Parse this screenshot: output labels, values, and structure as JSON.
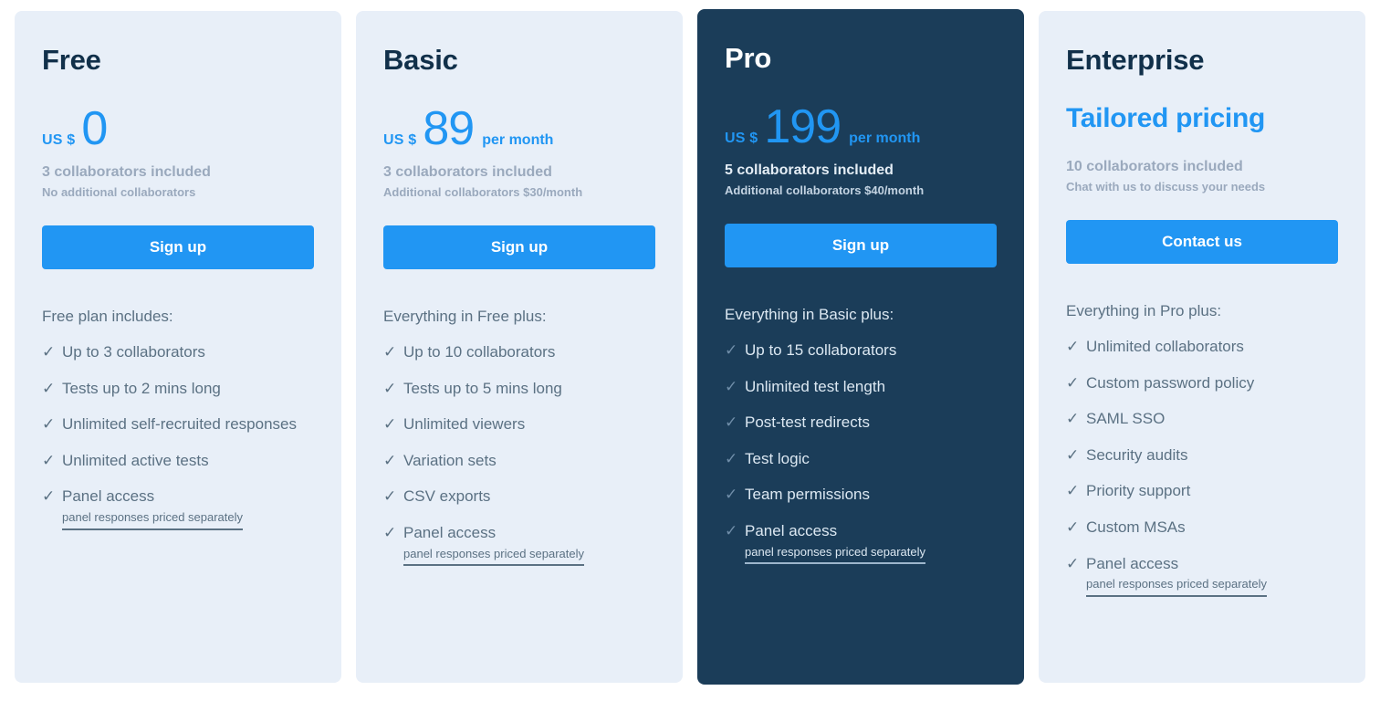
{
  "plans": [
    {
      "name": "Free",
      "featured": false,
      "price": {
        "currency": "US $",
        "amount": "0",
        "period": "",
        "custom": ""
      },
      "collaborators_included": "3 collaborators included",
      "collaborators_additional": "No additional collaborators",
      "cta_label": "Sign up",
      "features_heading": "Free plan includes:",
      "features": [
        {
          "label": "Up to 3 collaborators",
          "note": ""
        },
        {
          "label": "Tests up to 2 mins long",
          "note": ""
        },
        {
          "label": "Unlimited self-recruited responses",
          "note": ""
        },
        {
          "label": "Unlimited active tests",
          "note": ""
        },
        {
          "label": "Panel access",
          "note": "panel responses priced separately"
        }
      ]
    },
    {
      "name": "Basic",
      "featured": false,
      "price": {
        "currency": "US $",
        "amount": "89",
        "period": "per month",
        "custom": ""
      },
      "collaborators_included": "3 collaborators included",
      "collaborators_additional": "Additional collaborators $30/month",
      "cta_label": "Sign up",
      "features_heading": "Everything in Free plus:",
      "features": [
        {
          "label": "Up to 10 collaborators",
          "note": ""
        },
        {
          "label": "Tests up to 5 mins long",
          "note": ""
        },
        {
          "label": "Unlimited viewers",
          "note": ""
        },
        {
          "label": "Variation sets",
          "note": ""
        },
        {
          "label": "CSV exports",
          "note": ""
        },
        {
          "label": "Panel access",
          "note": "panel responses priced separately"
        }
      ]
    },
    {
      "name": "Pro",
      "featured": true,
      "price": {
        "currency": "US $",
        "amount": "199",
        "period": "per month",
        "custom": ""
      },
      "collaborators_included": "5 collaborators included",
      "collaborators_additional": "Additional collaborators $40/month",
      "cta_label": "Sign up",
      "features_heading": "Everything in Basic plus:",
      "features": [
        {
          "label": "Up to 15 collaborators",
          "note": ""
        },
        {
          "label": "Unlimited test length",
          "note": ""
        },
        {
          "label": "Post-test redirects",
          "note": ""
        },
        {
          "label": "Test logic",
          "note": ""
        },
        {
          "label": "Team permissions",
          "note": ""
        },
        {
          "label": "Panel access",
          "note": "panel responses priced separately"
        }
      ]
    },
    {
      "name": "Enterprise",
      "featured": false,
      "price": {
        "currency": "",
        "amount": "",
        "period": "",
        "custom": "Tailored pricing"
      },
      "collaborators_included": "10 collaborators included",
      "collaborators_additional": "Chat with us to discuss your needs",
      "cta_label": "Contact us",
      "features_heading": "Everything in Pro plus:",
      "features": [
        {
          "label": "Unlimited collaborators",
          "note": ""
        },
        {
          "label": "Custom password policy",
          "note": ""
        },
        {
          "label": "SAML SSO",
          "note": ""
        },
        {
          "label": "Security audits",
          "note": ""
        },
        {
          "label": "Priority support",
          "note": ""
        },
        {
          "label": "Custom MSAs",
          "note": ""
        },
        {
          "label": "Panel access",
          "note": "panel responses priced separately"
        }
      ]
    }
  ],
  "icons": {
    "check": "✓"
  },
  "colors": {
    "accent": "#2196f3",
    "card_light_bg": "#e8eff8",
    "card_featured_bg": "#1b3d59",
    "title_dark": "#11304a",
    "body_text": "#5b7183",
    "muted_text": "#9aa9bd"
  }
}
